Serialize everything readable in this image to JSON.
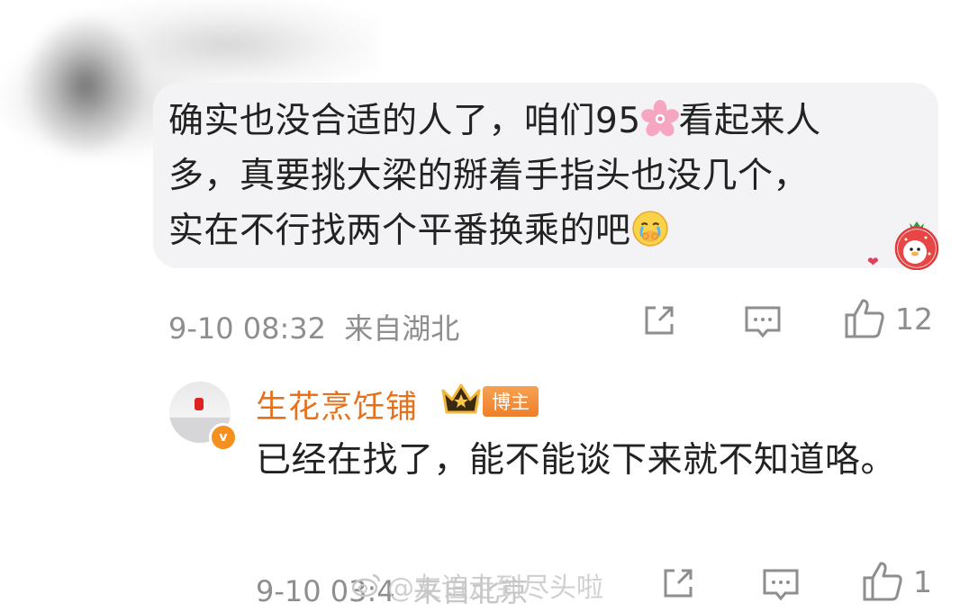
{
  "comment": {
    "text_line1_a": "确实也没合适的人了，咱们95",
    "text_line1_b": "看起来人",
    "text_line2": "多，真要挑大梁的掰着手指头也没几个，",
    "text_line3": "实在不行找两个平番换乘的吧",
    "inline_emoji_1": "cherry-blossom",
    "inline_emoji_2": "crying-face",
    "timestamp": "9-10 08:32",
    "location": "来自湖北",
    "like_count": "12"
  },
  "reply": {
    "username": "生花烹饪铺",
    "badge": "博主",
    "text": "已经在找了，能不能谈下来就不知道咯。",
    "timestamp": "9-10 03:4",
    "location": "来自北京",
    "like_count": "1"
  },
  "watermark": {
    "text": "@友谊走到尽头啦"
  },
  "colors": {
    "accent_username": "#e8701a",
    "bubble_bg": "#f3f2f4",
    "meta_gray": "#8e8e8e",
    "badge_orange": "#f08a34"
  }
}
